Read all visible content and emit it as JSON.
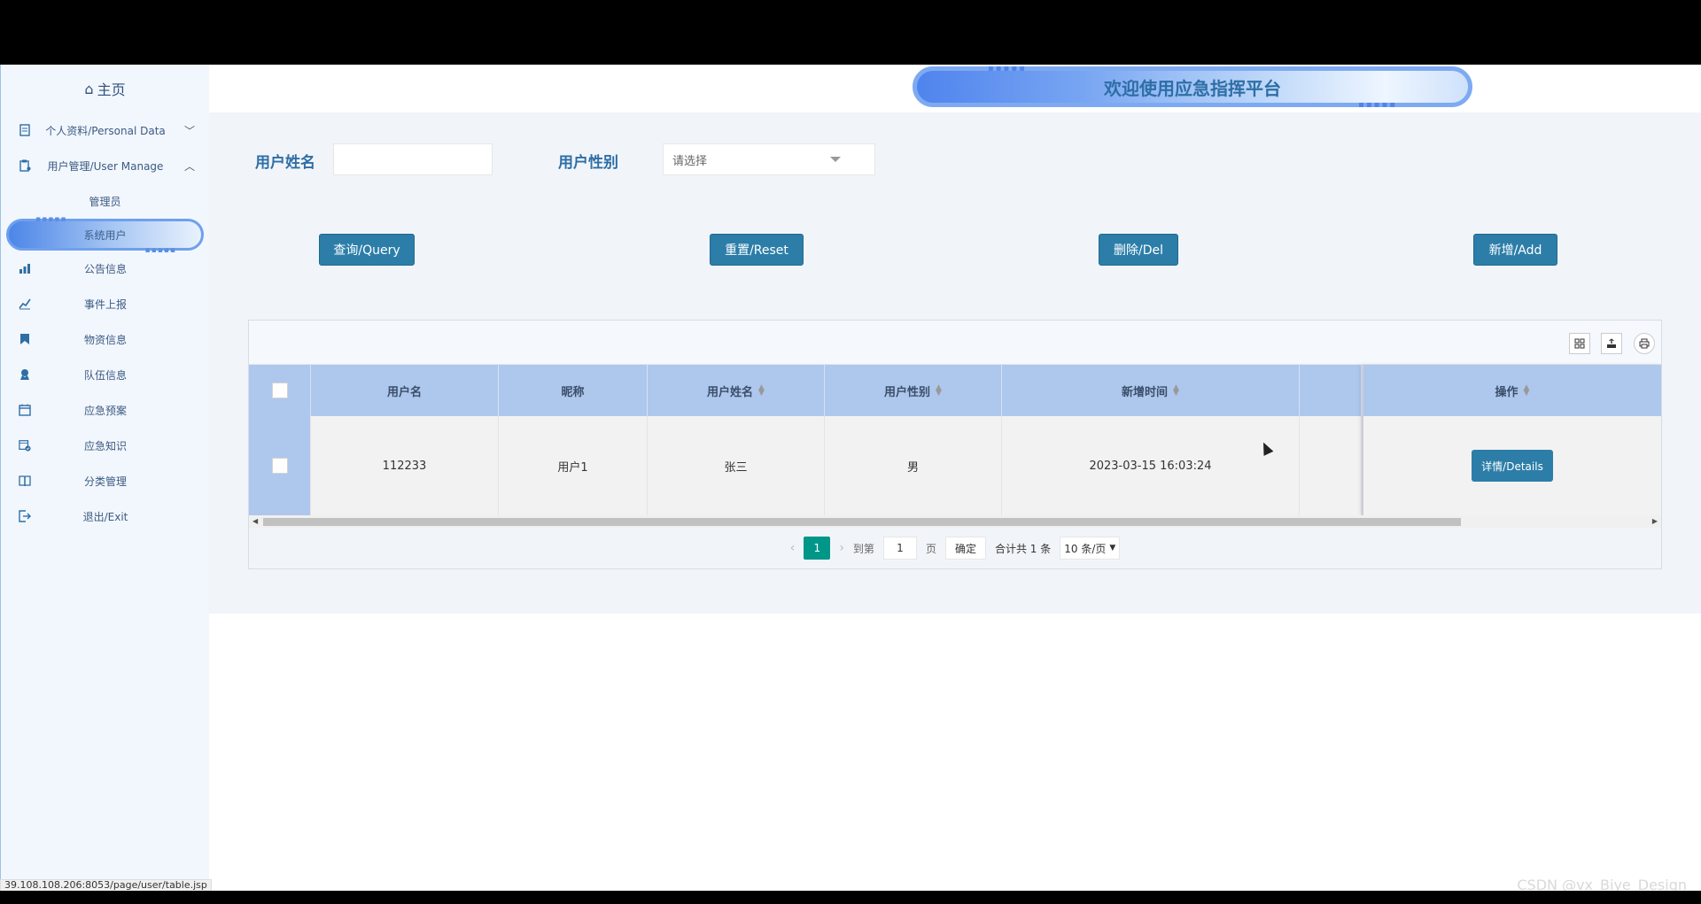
{
  "sidebar": {
    "home_label": "主页",
    "items": [
      {
        "label": "个人资料/Personal Data",
        "icon": "document-icon",
        "chevron": "﹀"
      },
      {
        "label": "用户管理/User Manage",
        "icon": "clipboard-user-icon",
        "chevron": "︿"
      }
    ],
    "subitems": [
      {
        "label": "管理员"
      },
      {
        "label": "系统用户",
        "active": true
      }
    ],
    "links": [
      {
        "label": "公告信息",
        "icon": "announcement-icon"
      },
      {
        "label": "事件上报",
        "icon": "chart-icon"
      },
      {
        "label": "物资信息",
        "icon": "bookmark-icon"
      },
      {
        "label": "队伍信息",
        "icon": "team-icon"
      },
      {
        "label": "应急预案",
        "icon": "calendar-icon"
      },
      {
        "label": "应急知识",
        "icon": "calendar-check-icon"
      },
      {
        "label": "分类管理",
        "icon": "book-icon"
      },
      {
        "label": "退出/Exit",
        "icon": "exit-icon"
      }
    ]
  },
  "header": {
    "title": "欢迎使用应急指挥平台"
  },
  "search": {
    "name_label": "用户姓名",
    "name_value": "",
    "gender_label": "用户性别",
    "gender_placeholder": "请选择"
  },
  "actions": {
    "query": "查询/Query",
    "reset": "重置/Reset",
    "delete": "删除/Del",
    "add": "新增/Add"
  },
  "table": {
    "columns": [
      "用户名",
      "昵称",
      "用户姓名",
      "用户性别",
      "新增时间",
      "",
      "操作"
    ],
    "rows": [
      {
        "username": "112233",
        "nickname": "用户1",
        "realname": "张三",
        "gender": "男",
        "created": "2023-03-15 16:03:24",
        "action": "详情/Details"
      }
    ]
  },
  "pager": {
    "current_page": "1",
    "goto_label": "到第",
    "goto_value": "1",
    "page_unit": "页",
    "confirm": "确定",
    "total": "合计共 1 条",
    "page_size": "10 条/页"
  },
  "statusbar": {
    "url": "39.108.108.206:8053/page/user/table.jsp"
  },
  "watermark": "CSDN @vx_Biye_Design",
  "colors": {
    "accent": "#2c7ea8",
    "header_row": "#aec7ec",
    "pager_current": "#009688"
  }
}
